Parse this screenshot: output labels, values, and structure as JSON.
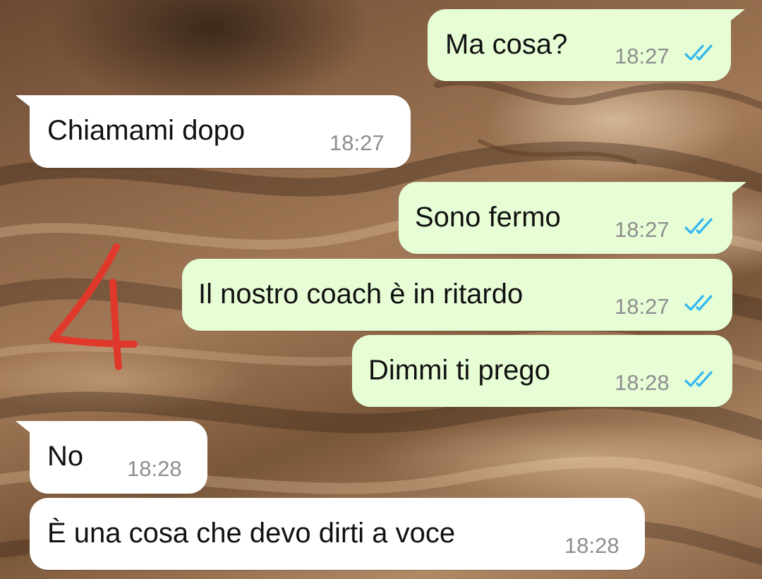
{
  "chat": {
    "messages": [
      {
        "direction": "outgoing",
        "text": "Ma cosa?",
        "time": "18:27",
        "status": "read"
      },
      {
        "direction": "incoming",
        "text": "Chiamami dopo",
        "time": "18:27"
      },
      {
        "direction": "outgoing",
        "text": "Sono fermo",
        "time": "18:27",
        "status": "read"
      },
      {
        "direction": "outgoing",
        "text": "Il nostro coach è in ritardo",
        "time": "18:27",
        "status": "read"
      },
      {
        "direction": "outgoing",
        "text": "Dimmi ti prego",
        "time": "18:28",
        "status": "read"
      },
      {
        "direction": "incoming",
        "text": "No",
        "time": "18:28"
      },
      {
        "direction": "incoming",
        "text": "È una cosa che devo dirti a voce",
        "time": "18:28"
      }
    ]
  },
  "annotation": {
    "mark": "4",
    "color": "#e0392b"
  },
  "colors": {
    "outgoing_bubble": "#e7fdd6",
    "incoming_bubble": "#ffffff",
    "read_ticks": "#34b7f1",
    "timestamp": "#8e8e8e"
  },
  "icons": {
    "read_receipt": "double-check-icon"
  }
}
